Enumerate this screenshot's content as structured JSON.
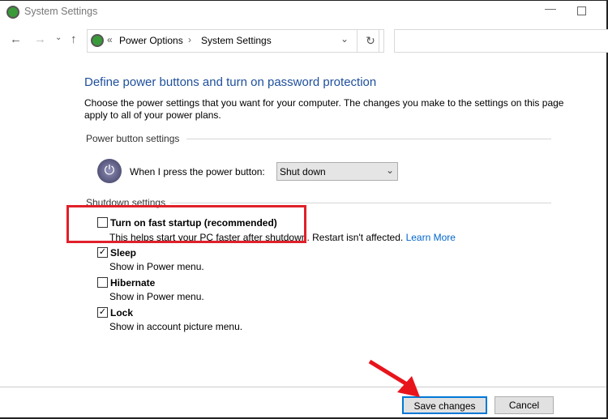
{
  "window": {
    "title": "System Settings"
  },
  "address": {
    "breadcrumb": [
      "Power Options",
      "System Settings"
    ],
    "prefix": "«",
    "sep": "›"
  },
  "search": {
    "placeholder": ""
  },
  "main": {
    "heading": "Define power buttons and turn on password protection",
    "description": "Choose the power settings that you want for your computer. The changes you make to the settings on this page apply to all of your power plans.",
    "power_section": "Power button settings",
    "power_label": "When I press the power button:",
    "power_value": "Shut down",
    "shutdown_section": "Shutdown settings",
    "options": [
      {
        "label": "Turn on fast startup (recommended)",
        "desc": "This helps start your PC faster after shutdown. Restart isn't affected.",
        "link": "Learn More",
        "checked": false
      },
      {
        "label": "Sleep",
        "desc": "Show in Power menu.",
        "checked": true
      },
      {
        "label": "Hibernate",
        "desc": "Show in Power menu.",
        "checked": false
      },
      {
        "label": "Lock",
        "desc": "Show in account picture menu.",
        "checked": true
      }
    ]
  },
  "footer": {
    "save": "Save changes",
    "cancel": "Cancel"
  },
  "annotations": {
    "highlight_color": "#e0202a",
    "arrow_color": "#e8141c"
  }
}
